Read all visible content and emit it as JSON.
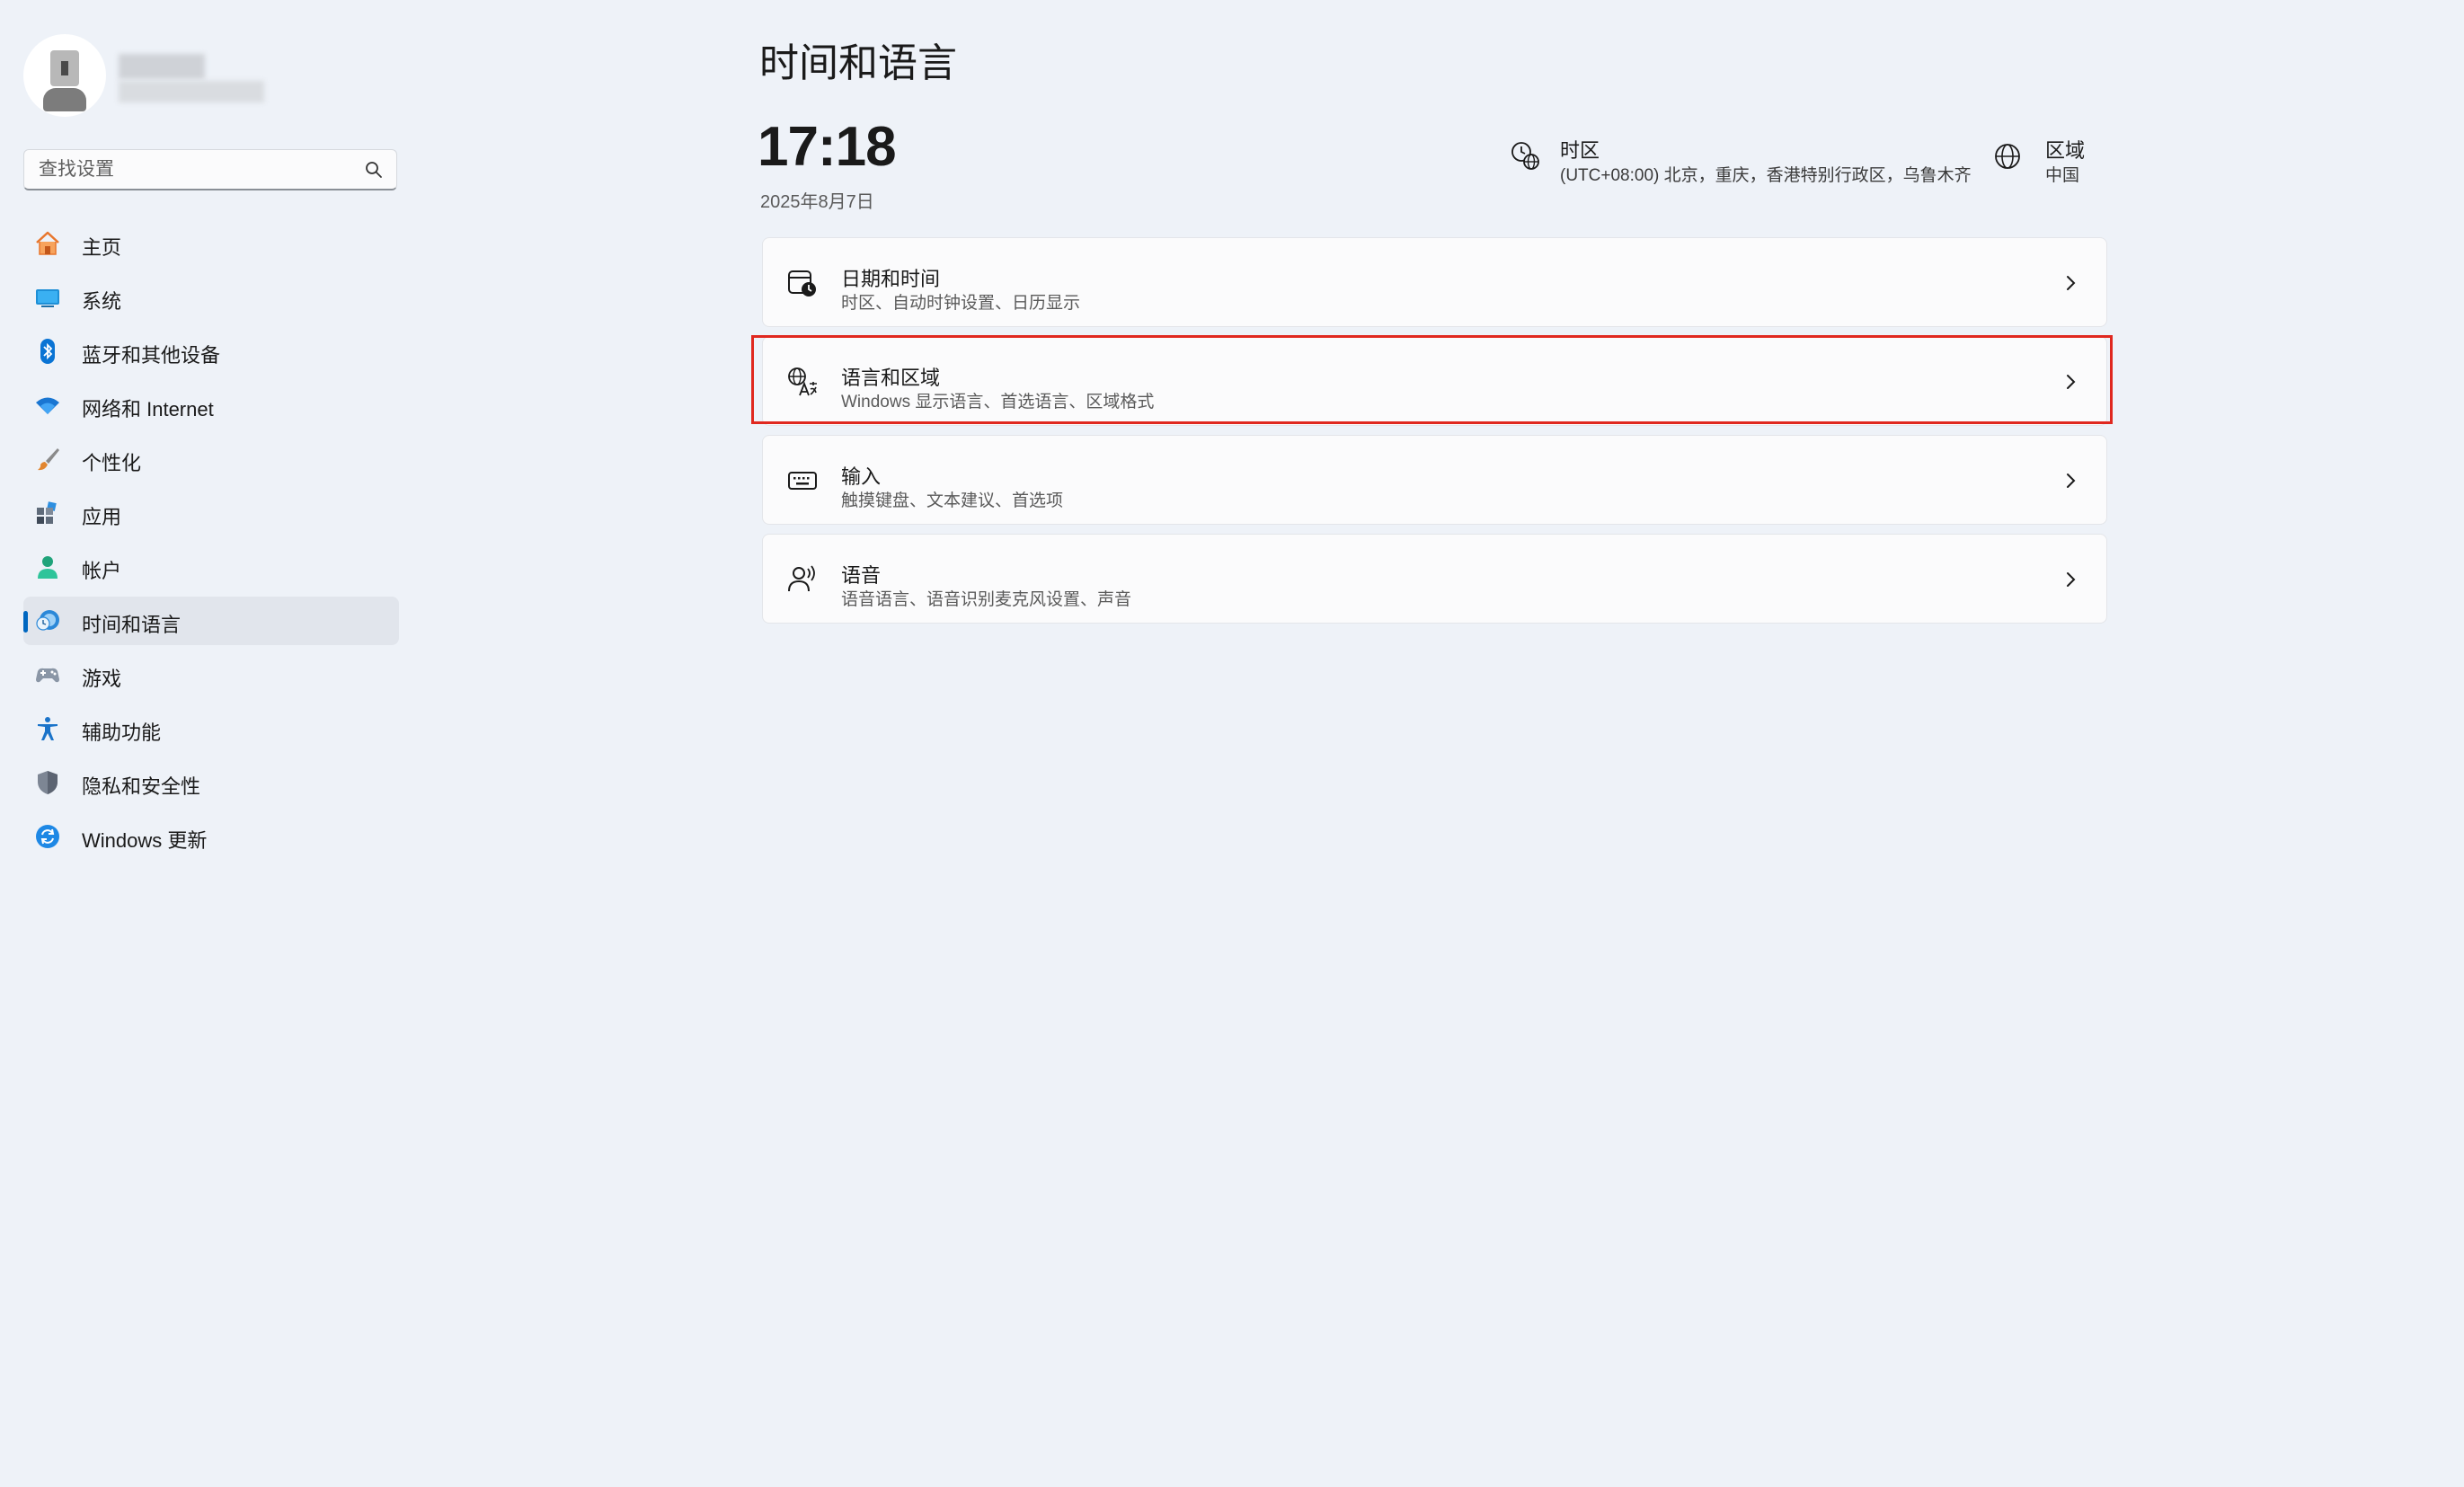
{
  "search": {
    "placeholder": "查找设置"
  },
  "sidebar": {
    "items": [
      {
        "label": "主页",
        "icon": "home-icon"
      },
      {
        "label": "系统",
        "icon": "system-icon"
      },
      {
        "label": "蓝牙和其他设备",
        "icon": "bluetooth-icon"
      },
      {
        "label": "网络和 Internet",
        "icon": "wifi-icon"
      },
      {
        "label": "个性化",
        "icon": "brush-icon"
      },
      {
        "label": "应用",
        "icon": "apps-icon"
      },
      {
        "label": "帐户",
        "icon": "account-icon"
      },
      {
        "label": "时间和语言",
        "icon": "time-language-icon",
        "active": true
      },
      {
        "label": "游戏",
        "icon": "gamepad-icon"
      },
      {
        "label": "辅助功能",
        "icon": "accessibility-icon"
      },
      {
        "label": "隐私和安全性",
        "icon": "shield-icon"
      },
      {
        "label": "Windows 更新",
        "icon": "update-icon"
      }
    ]
  },
  "main": {
    "title": "时间和语言",
    "clock": "17:18",
    "date": "2025年8月7日",
    "timezone": {
      "title": "时区",
      "value": "(UTC+08:00) 北京，重庆，香港特别行政区，乌鲁木齐"
    },
    "region": {
      "title": "区域",
      "value": "中国"
    },
    "cards": [
      {
        "title": "日期和时间",
        "desc": "时区、自动时钟设置、日历显示",
        "icon": "calendar-clock-icon"
      },
      {
        "title": "语言和区域",
        "desc": "Windows 显示语言、首选语言、区域格式",
        "icon": "language-icon"
      },
      {
        "title": "输入",
        "desc": "触摸键盘、文本建议、首选项",
        "icon": "keyboard-icon"
      },
      {
        "title": "语音",
        "desc": "语音语言、语音识别麦克风设置、声音",
        "icon": "speech-icon"
      }
    ]
  },
  "colors": {
    "accent": "#0067c0",
    "highlight": "#e0281f",
    "background": "#eef2f8"
  }
}
